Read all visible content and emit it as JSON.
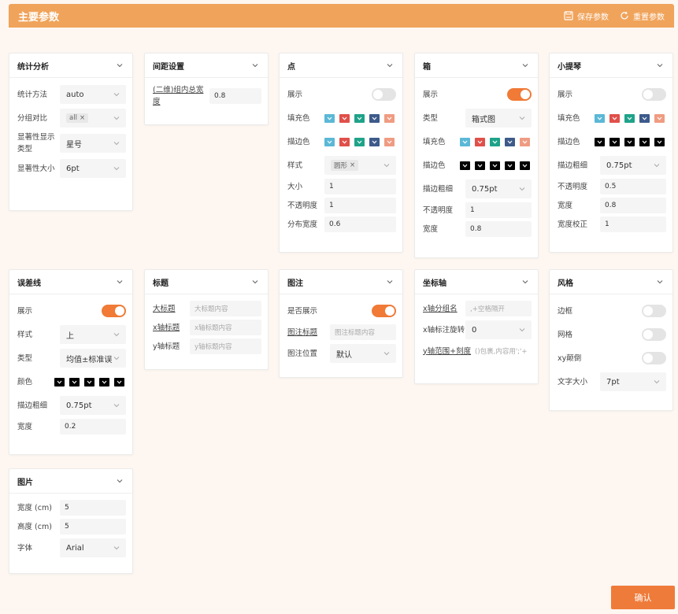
{
  "header": {
    "title": "主要参数",
    "save_label": "保存参数",
    "reset_label": "重置参数"
  },
  "confirm_label": "确认",
  "colors": {
    "accent": "#f07a36",
    "header": "#f0a35a"
  },
  "stats": {
    "title": "统计分析",
    "method_label": "统计方法",
    "method_value": "auto",
    "group_label": "分组对比",
    "group_tag": "all",
    "sigtype_label": "显著性显示类型",
    "sigtype_value": "星号",
    "sigsize_label": "显著性大小",
    "sigsize_value": "6pt"
  },
  "spacing": {
    "title": "间距设置",
    "label": "(二维)组内总宽度",
    "value": "0.8"
  },
  "point": {
    "title": "点",
    "show_label": "展示",
    "show": false,
    "fill_label": "填充色",
    "stroke_label": "描边色",
    "style_label": "样式",
    "style_tag": "圆形",
    "size_label": "大小",
    "size_value": "1",
    "opacity_label": "不透明度",
    "opacity_value": "1",
    "spread_label": "分布宽度",
    "spread_value": "0.6",
    "fill_colors": [
      "#5bb8d6",
      "#e0504a",
      "#1ea389",
      "#3d5a8a",
      "#ef9c82"
    ],
    "stroke_colors": [
      "#5bb8d6",
      "#e0504a",
      "#1ea389",
      "#3d5a8a",
      "#ef9c82"
    ]
  },
  "box": {
    "title": "箱",
    "show_label": "展示",
    "show": true,
    "type_label": "类型",
    "type_value": "箱式图",
    "fill_label": "填充色",
    "stroke_label": "描边色",
    "strokew_label": "描边粗细",
    "strokew_value": "0.75pt",
    "opacity_label": "不透明度",
    "opacity_value": "1",
    "width_label": "宽度",
    "width_value": "0.8",
    "fill_colors": [
      "#5bb8d6",
      "#e0504a",
      "#1ea389",
      "#3d5a8a",
      "#ef9c82"
    ],
    "stroke_colors": [
      "#000000",
      "#000000",
      "#000000",
      "#000000",
      "#000000"
    ]
  },
  "violin": {
    "title": "小提琴",
    "show_label": "展示",
    "show": false,
    "fill_label": "填充色",
    "stroke_label": "描边色",
    "strokew_label": "描边粗细",
    "strokew_value": "0.75pt",
    "opacity_label": "不透明度",
    "opacity_value": "0.5",
    "width_label": "宽度",
    "width_value": "0.8",
    "adjust_label": "宽度校正",
    "adjust_value": "1",
    "fill_colors": [
      "#5bb8d6",
      "#e0504a",
      "#1ea389",
      "#3d5a8a",
      "#ef9c82"
    ],
    "stroke_colors": [
      "#000000",
      "#000000",
      "#000000",
      "#000000",
      "#000000"
    ]
  },
  "errorbar": {
    "title": "误差线",
    "show_label": "展示",
    "show": true,
    "style_label": "样式",
    "style_value": "上",
    "type_label": "类型",
    "type_value": "均值±标准误",
    "color_label": "颜色",
    "strokew_label": "描边粗细",
    "strokew_value": "0.75pt",
    "width_label": "宽度",
    "width_value": "0.2",
    "colors": [
      "#000000",
      "#000000",
      "#000000",
      "#000000",
      "#000000"
    ]
  },
  "titles": {
    "title": "标题",
    "main_label": "大标题",
    "main_placeholder": "大标题内容",
    "x_label": "x轴标题",
    "x_placeholder": "x轴标题内容",
    "y_label": "y轴标题",
    "y_placeholder": "y轴标题内容"
  },
  "legend": {
    "title": "图注",
    "show_label": "是否展示",
    "show": true,
    "title_label": "图注标题",
    "title_placeholder": "图注标题内容",
    "pos_label": "图注位置",
    "pos_value": "默认"
  },
  "axis": {
    "title": "坐标轴",
    "xgroup_label": "x轴分组名",
    "xgroup_placeholder": ",+空格隔开",
    "xrot_label": "x轴标注旋转",
    "xrot_value": "0",
    "yrange_label": "y轴范围+刻度",
    "yrange_placeholder": "()包裹,内容用';'+"
  },
  "style": {
    "title": "风格",
    "border_label": "边框",
    "border": false,
    "grid_label": "网格",
    "grid": false,
    "xyflip_label": "xy颠倒",
    "xyflip": false,
    "fontsize_label": "文字大小",
    "fontsize_value": "7pt"
  },
  "image": {
    "title": "图片",
    "w_label": "宽度 (cm)",
    "w_value": "5",
    "h_label": "高度 (cm)",
    "h_value": "5",
    "font_label": "字体",
    "font_value": "Arial"
  }
}
